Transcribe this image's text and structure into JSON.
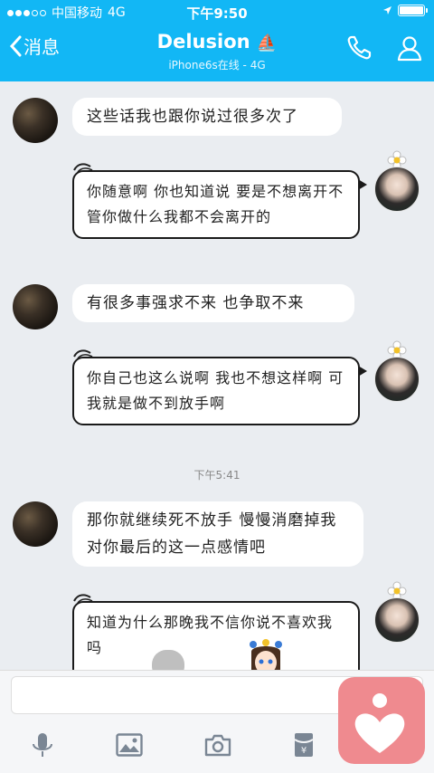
{
  "status_bar": {
    "carrier": "中国移动",
    "network": "4G",
    "time": "下午9:50",
    "battery_level": 1.0
  },
  "header": {
    "back_label": "消息",
    "title": "Delusion",
    "title_emoji": "⛵",
    "subtitle": "iPhone6s在线 - 4G"
  },
  "messages": [
    {
      "side": "left",
      "text": "这些话我也跟你说过很多次了"
    },
    {
      "side": "right",
      "text": "你随意啊  你也知道说 要是不想离开不管你做什么我都不会离开的"
    },
    {
      "side": "left",
      "text": "有很多事强求不来  也争取不来"
    },
    {
      "side": "right",
      "text": "你自己也这么说啊  我也不想这样啊 可我就是做不到放手啊"
    },
    {
      "side": "left",
      "text": "那你就继续死不放手  慢慢消磨掉我对你最后的这一点感情吧"
    },
    {
      "side": "right",
      "text": "知道为什么那晚我不信你说不喜欢我吗"
    }
  ],
  "timestamp": "下午5:41",
  "input": {
    "placeholder": ""
  },
  "toolbar": [
    "microphone-icon",
    "image-icon",
    "camera-icon",
    "red-packet-icon",
    "emoji-icon"
  ],
  "colors": {
    "accent": "#12b7f5",
    "heart_button": "#ef8a8f",
    "background": "#eaedf1"
  }
}
